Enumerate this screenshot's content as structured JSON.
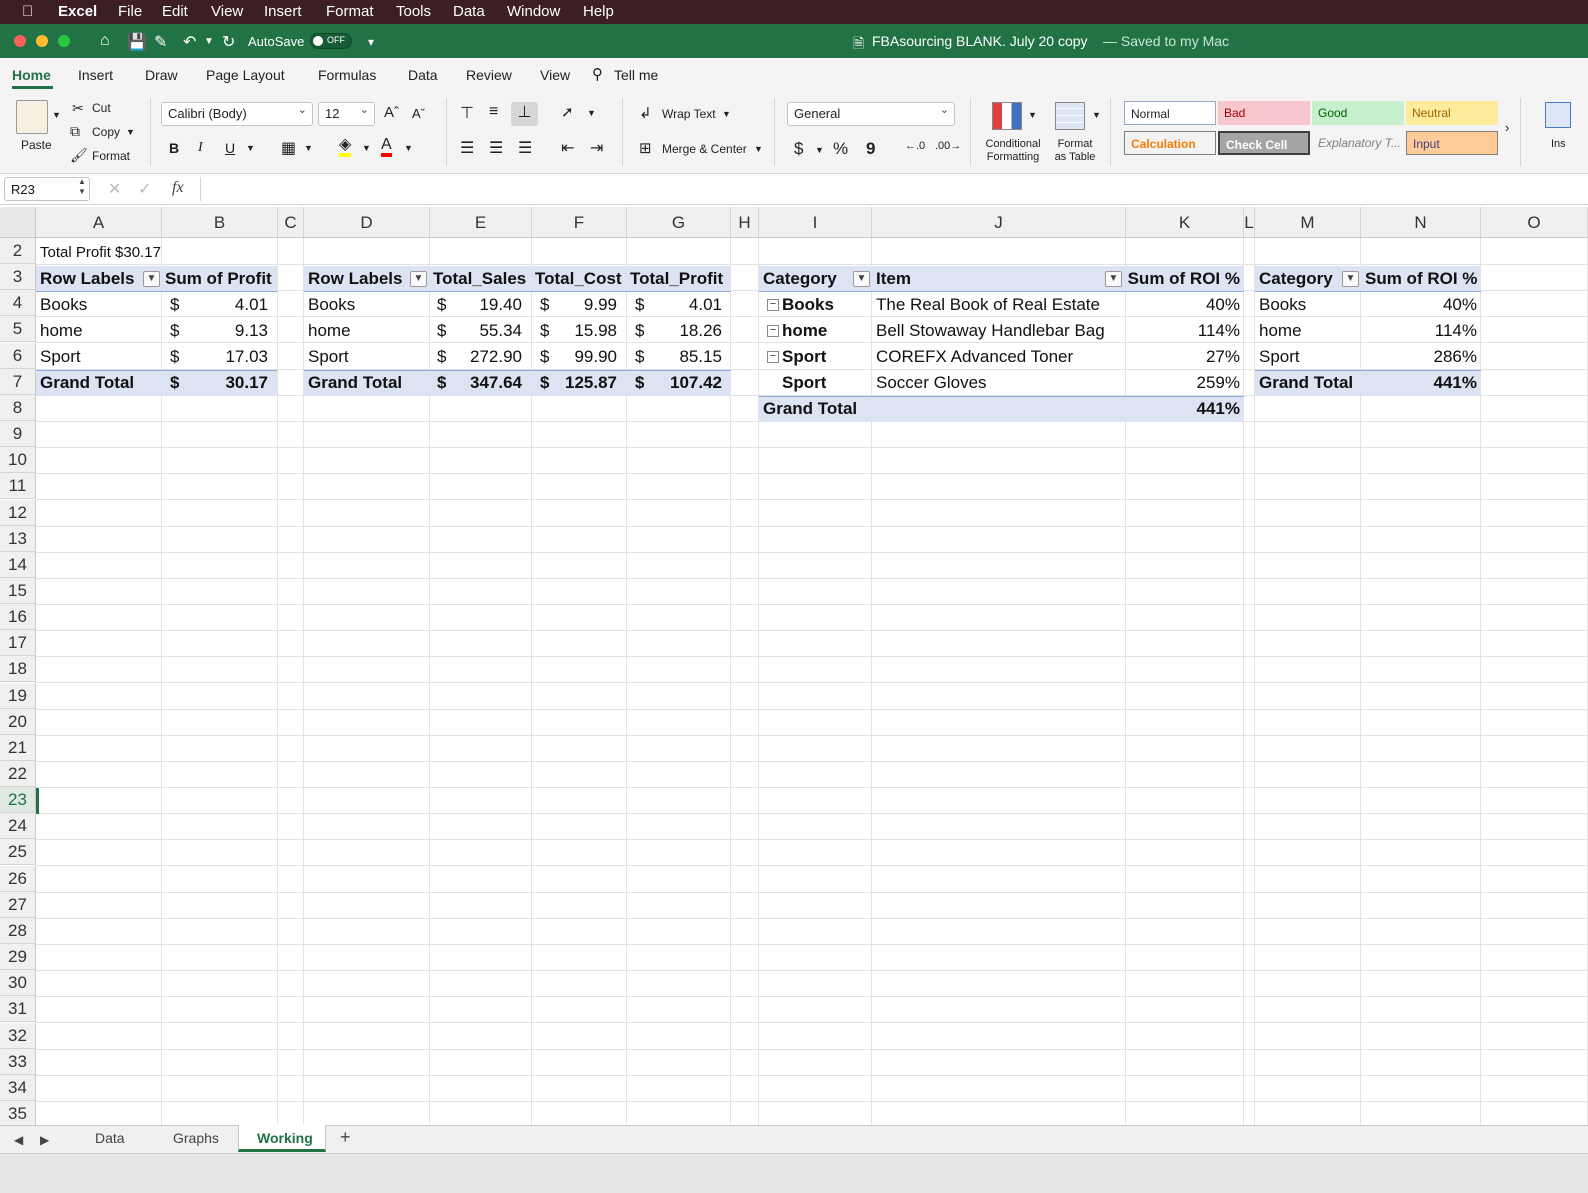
{
  "menubar": {
    "apple": "",
    "app": "Excel",
    "items": [
      "File",
      "Edit",
      "View",
      "Insert",
      "Format",
      "Tools",
      "Data",
      "Window",
      "Help"
    ]
  },
  "titlebar": {
    "autosave_label": "AutoSave",
    "autosave_state": "OFF",
    "doc_title": "FBAsourcing BLANK. July 20 copy",
    "saved_status": "— Saved to my Mac"
  },
  "ribbon_tabs": [
    "Home",
    "Insert",
    "Draw",
    "Page Layout",
    "Formulas",
    "Data",
    "Review",
    "View",
    "Tell me"
  ],
  "ribbon": {
    "paste": "Paste",
    "cut": "Cut",
    "copy": "Copy",
    "format": "Format",
    "font_name": "Calibri (Body)",
    "font_size": "12",
    "bold": "B",
    "italic": "I",
    "underline": "U",
    "wrap_text": "Wrap Text",
    "merge_center": "Merge & Center",
    "number_format": "General",
    "currency": "$",
    "percent": "%",
    "comma": "9",
    "conditional_formatting": "Conditional\nFormatting",
    "format_as_table": "Format\nas Table",
    "insert": "Ins",
    "styles": [
      {
        "label": "Normal",
        "bg": "#ffffff",
        "fg": "#222222",
        "border": "#9aa8c8"
      },
      {
        "label": "Bad",
        "bg": "#f8c7ce",
        "fg": "#9c0006",
        "border": "#f8c7ce"
      },
      {
        "label": "Good",
        "bg": "#c6efce",
        "fg": "#006100",
        "border": "#c6efce"
      },
      {
        "label": "Neutral",
        "bg": "#ffeb9c",
        "fg": "#9c6500",
        "border": "#ffeb9c"
      },
      {
        "label": "Calculation",
        "bg": "#f2f2f2",
        "fg": "#fa7d00",
        "border": "#7f7f7f"
      },
      {
        "label": "Check Cell",
        "bg": "#a5a5a5",
        "fg": "#ffffff",
        "border": "#3f3f3f"
      },
      {
        "label": "Explanatory T...",
        "bg": "#f4f4f4",
        "fg": "#7f7f7f",
        "border": "#f4f4f4"
      },
      {
        "label": "Input",
        "bg": "#ffcc99",
        "fg": "#3f3f76",
        "border": "#7f7f7f"
      }
    ]
  },
  "formula_bar": {
    "name_box": "R23",
    "fx": "fx",
    "content": ""
  },
  "columns": [
    "A",
    "B",
    "C",
    "D",
    "E",
    "F",
    "G",
    "H",
    "I",
    "J",
    "K",
    "L",
    "M",
    "N",
    "O"
  ],
  "rows": [
    "2",
    "3",
    "4",
    "5",
    "6",
    "7",
    "8",
    "9",
    "10",
    "11",
    "12",
    "13",
    "14",
    "15",
    "16",
    "17",
    "18",
    "19",
    "20",
    "21",
    "22",
    "23",
    "24",
    "25",
    "26",
    "27",
    "28",
    "29",
    "30",
    "31",
    "32",
    "33",
    "34",
    "35"
  ],
  "cells": {
    "A2": "Total Profit $30.17",
    "pivot1": {
      "headers": [
        "Row Labels",
        "Sum of Profit"
      ],
      "rows": [
        {
          "label": "Books",
          "cur": "$",
          "val": "4.01"
        },
        {
          "label": "home",
          "cur": "$",
          "val": "9.13"
        },
        {
          "label": "Sport",
          "cur": "$",
          "val": "17.03"
        }
      ],
      "total": {
        "label": "Grand Total",
        "cur": "$",
        "val": "30.17"
      }
    },
    "pivot2": {
      "headers": [
        "Row Labels",
        "Total_Sales",
        "Total_Cost",
        "Total_Profit"
      ],
      "rows": [
        {
          "label": "Books",
          "s": "19.40",
          "c": "9.99",
          "p": "4.01"
        },
        {
          "label": "home",
          "s": "55.34",
          "c": "15.98",
          "p": "18.26"
        },
        {
          "label": "Sport",
          "s": "272.90",
          "c": "99.90",
          "p": "85.15"
        }
      ],
      "total": {
        "label": "Grand Total",
        "s": "347.64",
        "c": "125.87",
        "p": "107.42"
      },
      "cur": "$"
    },
    "pivot3": {
      "headers": [
        "Category",
        "Item",
        "Sum of ROI %"
      ],
      "rows": [
        {
          "cat": "Books",
          "item": "The Real Book of Real Estate",
          "val": "40%"
        },
        {
          "cat": "home",
          "item": "Bell Stowaway Handlebar Bag",
          "val": "114%"
        },
        {
          "cat": "Sport",
          "item": "COREFX Advanced Toner",
          "val": "27%"
        },
        {
          "cat": "Sport",
          "item": "Soccer Gloves",
          "val": "259%"
        }
      ],
      "total": {
        "label": "Grand Total",
        "val": "441%"
      }
    },
    "pivot4": {
      "headers": [
        "Category",
        "Sum of ROI %"
      ],
      "rows": [
        {
          "cat": "Books",
          "val": "40%"
        },
        {
          "cat": "home",
          "val": "114%"
        },
        {
          "cat": "Sport",
          "val": "286%"
        }
      ],
      "total": {
        "label": "Grand Total",
        "val": "441%"
      }
    }
  },
  "sheet_tabs": {
    "items": [
      "Data",
      "Graphs",
      "Working"
    ],
    "active": "Working",
    "add": "+"
  },
  "colors": {
    "excel_green": "#217346",
    "pivot_header": "#dce3f2",
    "pivot_border": "#8ea9db"
  }
}
